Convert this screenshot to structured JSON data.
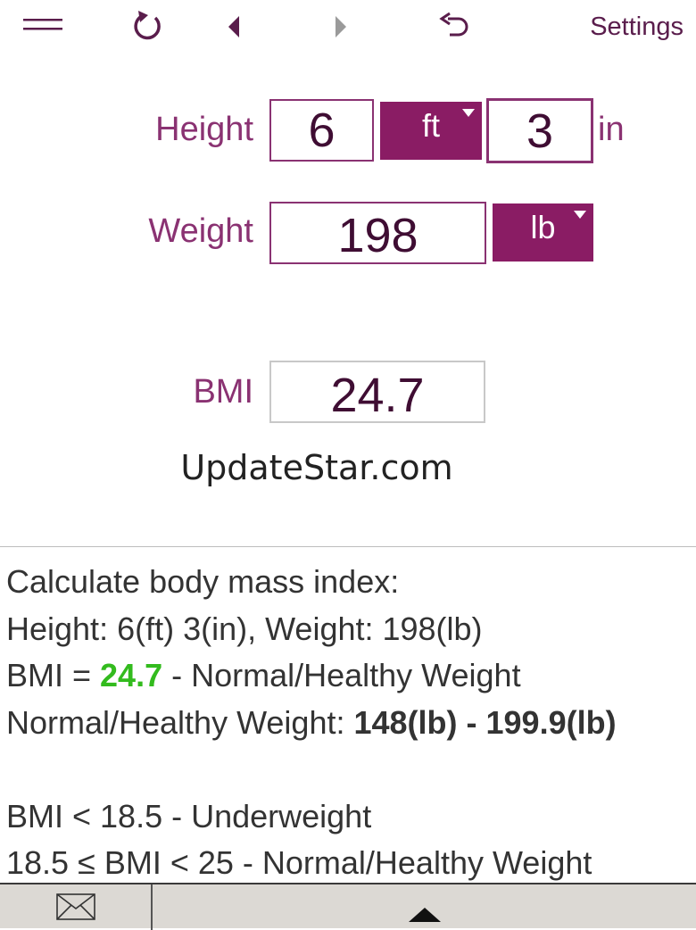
{
  "toolbar": {
    "icons": [
      "menu-icon",
      "refresh-icon",
      "back-arrow-icon",
      "forward-arrow-icon",
      "undo-icon"
    ],
    "settings_label": "Settings"
  },
  "form": {
    "height_label": "Height",
    "height_ft_value": "6",
    "height_ft_unit": "ft",
    "height_in_value": "3",
    "height_in_unit": "in",
    "weight_label": "Weight",
    "weight_value": "198",
    "weight_unit": "lb",
    "bmi_label": "BMI",
    "bmi_value": "24.7"
  },
  "watermark": "UpdateStar.com",
  "info": {
    "line1": "Calculate body mass index:",
    "line2": "Height: 6(ft) 3(in), Weight: 198(lb)",
    "line3_prefix": "BMI = ",
    "line3_value": "24.7",
    "line3_suffix": " - Normal/Healthy Weight",
    "line4_prefix": "Normal/Healthy Weight: ",
    "line4_range": "148(lb) - 199.9(lb)",
    "line5": "BMI < 18.5 - Underweight",
    "line6": "18.5 ≤ BMI < 25 - Normal/Healthy Weight"
  },
  "colors": {
    "accent": "#8a1c64",
    "label": "#8a3272",
    "bmi_highlight": "#33bb1e"
  },
  "bottombar": {
    "icons": [
      "mail-icon",
      "expand-up-icon"
    ]
  }
}
